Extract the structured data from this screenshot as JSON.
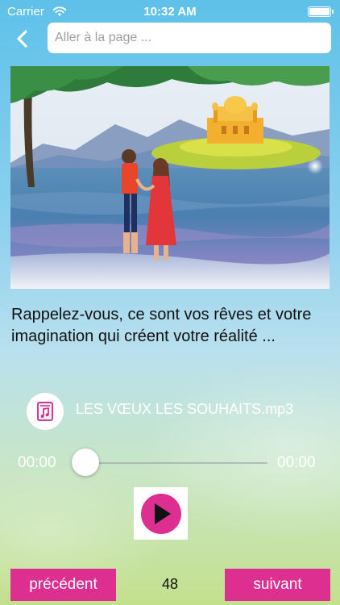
{
  "status_bar": {
    "carrier": "Carrier",
    "time": "10:32 AM"
  },
  "nav": {
    "back_icon": "chevron-left-icon",
    "search_placeholder": "Aller à la page ..."
  },
  "illustration": {
    "subject": "couple-by-lake-icon"
  },
  "caption": "Rappelez-vous, ce sont vos rêves et votre imagination qui créent votre réalité ...",
  "audio": {
    "file_icon": "music-file-icon",
    "title": "LES VŒUX LES SOUHAITS.mp3",
    "current_time": "00:00",
    "total_time": "00:00",
    "progress": 0,
    "play_icon": "play-icon"
  },
  "footer": {
    "prev_label": "précédent",
    "next_label": "suivant",
    "page_number": "48"
  },
  "colors": {
    "accent_pink": "#dd2f8f",
    "background_top": "#5ec1e9",
    "background_bottom": "#c3e08d",
    "slider_fill": "#2d7cf6"
  }
}
